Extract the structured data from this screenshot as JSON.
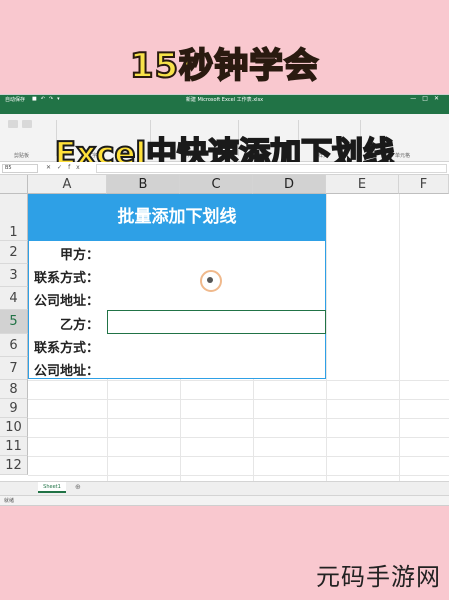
{
  "headline": "15秒钟学会",
  "overlay_title": "Excel中快速添加下划线",
  "watermark": "元码手游网",
  "window": {
    "qa_label": "自动保存",
    "doc_title": "新建 Microsoft Excel 工作表.xlsx",
    "ribbon_groups": [
      "剪贴板",
      "字体",
      "对齐方式",
      "数字",
      "样式",
      "单元格"
    ]
  },
  "formula_bar": {
    "name_box": "B5",
    "fx": "fx",
    "value": ""
  },
  "columns": [
    "A",
    "B",
    "C",
    "D",
    "E",
    "F"
  ],
  "rows": [
    "1",
    "2",
    "3",
    "4",
    "5",
    "6",
    "7",
    "8",
    "9",
    "10",
    "11",
    "12"
  ],
  "table": {
    "header": "批量添加下划线",
    "labels": [
      "甲方：",
      "联系方式：",
      "公司地址：",
      "乙方：",
      "联系方式：",
      "公司地址："
    ]
  },
  "sheet_tab": "Sheet1",
  "status": "就绪",
  "colors": {
    "background": "#f9c8cf",
    "excel_green": "#217346",
    "table_header": "#2ea0e6",
    "headline_yellow": "#f7e24a"
  }
}
